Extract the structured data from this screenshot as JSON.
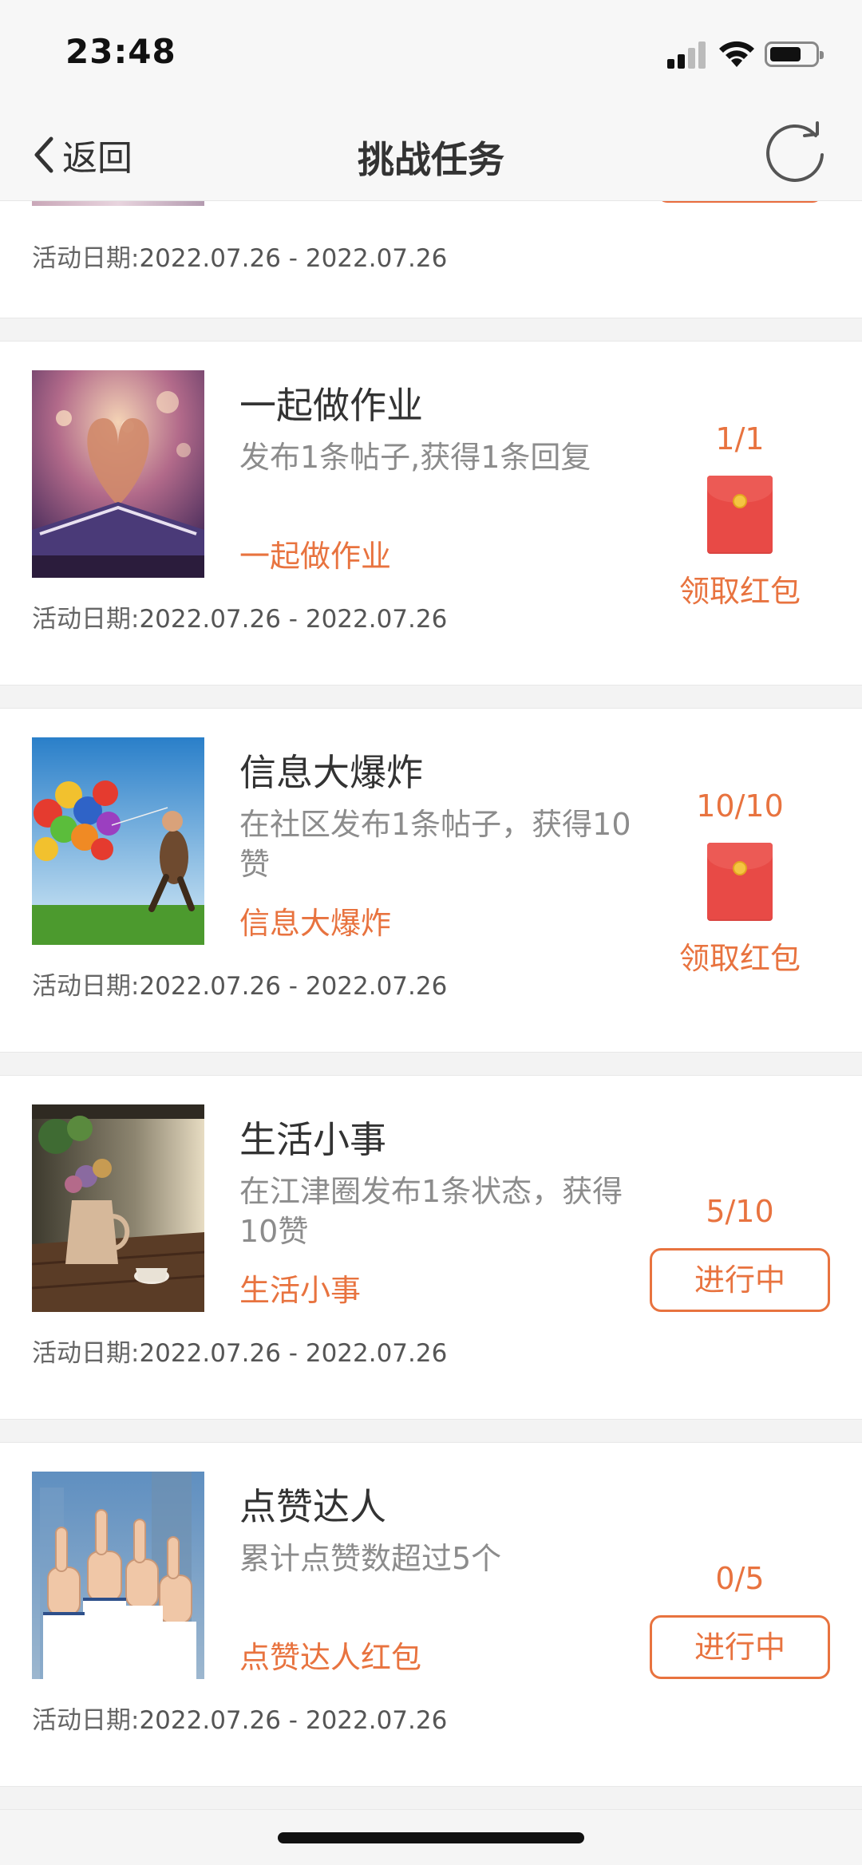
{
  "status_bar": {
    "time": "23:48"
  },
  "nav": {
    "back_label": "返回",
    "title": "挑战任务"
  },
  "partial_card": {
    "date_label": "活动日期:",
    "date_range": "2022.07.26 - 2022.07.26"
  },
  "tasks": [
    {
      "title": "一起做作业",
      "description": "发布1条帖子,获得1条回复",
      "tag": "一起做作业",
      "date_label": "活动日期:",
      "date_range": "2022.07.26 - 2022.07.26",
      "progress": "1/1",
      "action_label": "领取红包",
      "image": "book-heart-photo"
    },
    {
      "title": "信息大爆炸",
      "description": "在社区发布1条帖子，获得10赞",
      "tag": "信息大爆炸",
      "date_label": "活动日期:",
      "date_range": "2022.07.26 - 2022.07.26",
      "progress": "10/10",
      "action_label": "领取红包",
      "image": "balloons-child-photo"
    },
    {
      "title": "生活小事",
      "description": "在江津圈发布1条状态，获得10赞",
      "tag": "生活小事",
      "date_label": "活动日期:",
      "date_range": "2022.07.26 - 2022.07.26",
      "progress": "5/10",
      "action_label": "进行中",
      "image": "teapot-flowers-photo"
    },
    {
      "title": "点赞达人",
      "description": "累计点赞数超过5个",
      "tag": "点赞达人红包",
      "date_label": "活动日期:",
      "date_range": "2022.07.26 - 2022.07.26",
      "progress": "0/5",
      "action_label": "进行中",
      "image": "thumbs-up-photo"
    }
  ],
  "icons": {
    "back": "chevron-left-icon",
    "refresh": "refresh-icon",
    "red_envelope": "red-envelope-icon"
  },
  "colors": {
    "accent": "#e8733f",
    "envelope": "#e84a46"
  }
}
